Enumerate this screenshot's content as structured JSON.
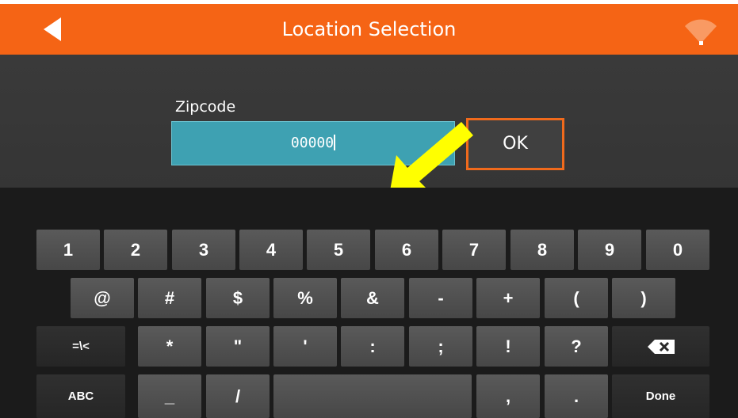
{
  "header": {
    "title": "Location Selection",
    "back_icon": "back-arrow-icon",
    "status_icon": "wifi-icon",
    "bar_color": "#f56415"
  },
  "zip": {
    "label": "Zipcode",
    "value": "00000",
    "field_color": "#3ea1b2"
  },
  "ok_label": "OK",
  "keyboard": {
    "row1": [
      "1",
      "2",
      "3",
      "4",
      "5",
      "6",
      "7",
      "8",
      "9",
      "0"
    ],
    "row2": [
      "@",
      "#",
      "$",
      "%",
      "&",
      "-",
      "+",
      "(",
      ")"
    ],
    "row3": [
      "=\\<",
      "*",
      "\"",
      "'",
      ":",
      ";",
      "!",
      "?"
    ],
    "row4": [
      "ABC",
      "_",
      "/",
      "",
      ",",
      ".",
      "Done"
    ]
  }
}
